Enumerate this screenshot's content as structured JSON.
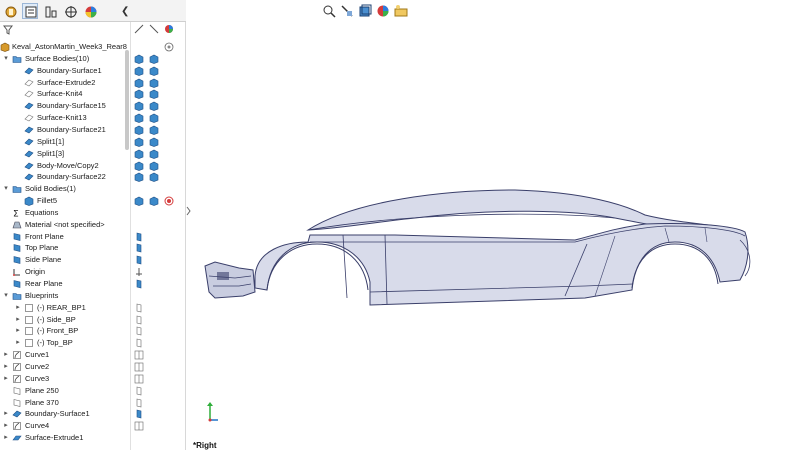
{
  "colors": {
    "accent": "#1e73c8",
    "surface_blue": "#3b89c9",
    "body_fill": "#d8dbea",
    "body_edge": "#3a3f6a"
  },
  "tabs": [
    {
      "icon": "feature-manager-icon"
    },
    {
      "icon": "property-manager-icon"
    },
    {
      "icon": "configuration-manager-icon"
    },
    {
      "icon": "dimxpert-icon"
    },
    {
      "icon": "display-manager-icon"
    }
  ],
  "tree": {
    "root": "Keval_AstonMartin_Week3_Rear8",
    "items": [
      {
        "label": "Surface Bodies(10)",
        "icon": "surface-bodies-folder-icon",
        "level": 0,
        "expanded": true
      },
      {
        "label": "Boundary-Surface1",
        "icon": "surface-body-icon",
        "level": 1
      },
      {
        "label": "Surface-Extrude2",
        "icon": "hidden-surface-icon",
        "level": 1
      },
      {
        "label": "Surface-Knit4",
        "icon": "hidden-surface-icon",
        "level": 1
      },
      {
        "label": "Boundary-Surface15",
        "icon": "surface-body-icon",
        "level": 1
      },
      {
        "label": "Surface-Knit13",
        "icon": "hidden-surface-icon",
        "level": 1
      },
      {
        "label": "Boundary-Surface21",
        "icon": "surface-body-icon",
        "level": 1
      },
      {
        "label": "Split1[1]",
        "icon": "surface-body-icon",
        "level": 1
      },
      {
        "label": "Split1[3]",
        "icon": "surface-body-icon",
        "level": 1
      },
      {
        "label": "Body-Move/Copy2",
        "icon": "surface-body-icon",
        "level": 1
      },
      {
        "label": "Boundary-Surface22",
        "icon": "surface-body-icon",
        "level": 1
      },
      {
        "label": "Solid Bodies(1)",
        "icon": "solid-bodies-folder-icon",
        "level": 0,
        "expanded": true
      },
      {
        "label": "Fillet5",
        "icon": "solid-body-icon",
        "level": 1
      },
      {
        "label": "Equations",
        "icon": "equations-icon",
        "level": 0
      },
      {
        "label": "Material <not specified>",
        "icon": "material-icon",
        "level": 0
      },
      {
        "label": "Front Plane",
        "icon": "plane-icon",
        "level": 0
      },
      {
        "label": "Top Plane",
        "icon": "plane-icon",
        "level": 0
      },
      {
        "label": "Side Plane",
        "icon": "plane-icon",
        "level": 0
      },
      {
        "label": "Origin",
        "icon": "origin-icon",
        "level": 0
      },
      {
        "label": "Rear Plane",
        "icon": "plane-icon",
        "level": 0
      },
      {
        "label": "Blueprints",
        "icon": "folder-icon",
        "level": 0,
        "expanded": true
      },
      {
        "label": "(-) REAR_BP1",
        "icon": "sketch-icon",
        "level": 1,
        "collapsible": true
      },
      {
        "label": "(-) Side_BP",
        "icon": "sketch-icon",
        "level": 1,
        "collapsible": true
      },
      {
        "label": "(-) Front_BP",
        "icon": "sketch-icon",
        "level": 1,
        "collapsible": true
      },
      {
        "label": "(-) Top_BP",
        "icon": "sketch-icon",
        "level": 1,
        "collapsible": true
      },
      {
        "label": "Curve1",
        "icon": "curve-icon",
        "level": 0,
        "collapsible": true
      },
      {
        "label": "Curve2",
        "icon": "curve-icon",
        "level": 0,
        "collapsible": true
      },
      {
        "label": "Curve3",
        "icon": "curve-icon",
        "level": 0,
        "collapsible": true
      },
      {
        "label": "Plane 250",
        "icon": "plane-outline-icon",
        "level": 0
      },
      {
        "label": "Plane 370",
        "icon": "plane-outline-icon",
        "level": 0
      },
      {
        "label": "Boundary-Surface1",
        "icon": "boundary-surface-feature-icon",
        "level": 0,
        "collapsible": true
      },
      {
        "label": "Curve4",
        "icon": "curve-icon",
        "level": 0,
        "collapsible": true
      },
      {
        "label": "Surface-Extrude1",
        "icon": "surface-extrude-feature-icon",
        "level": 0,
        "collapsible": true
      }
    ]
  },
  "viewport": {
    "view_label": "*Right"
  }
}
